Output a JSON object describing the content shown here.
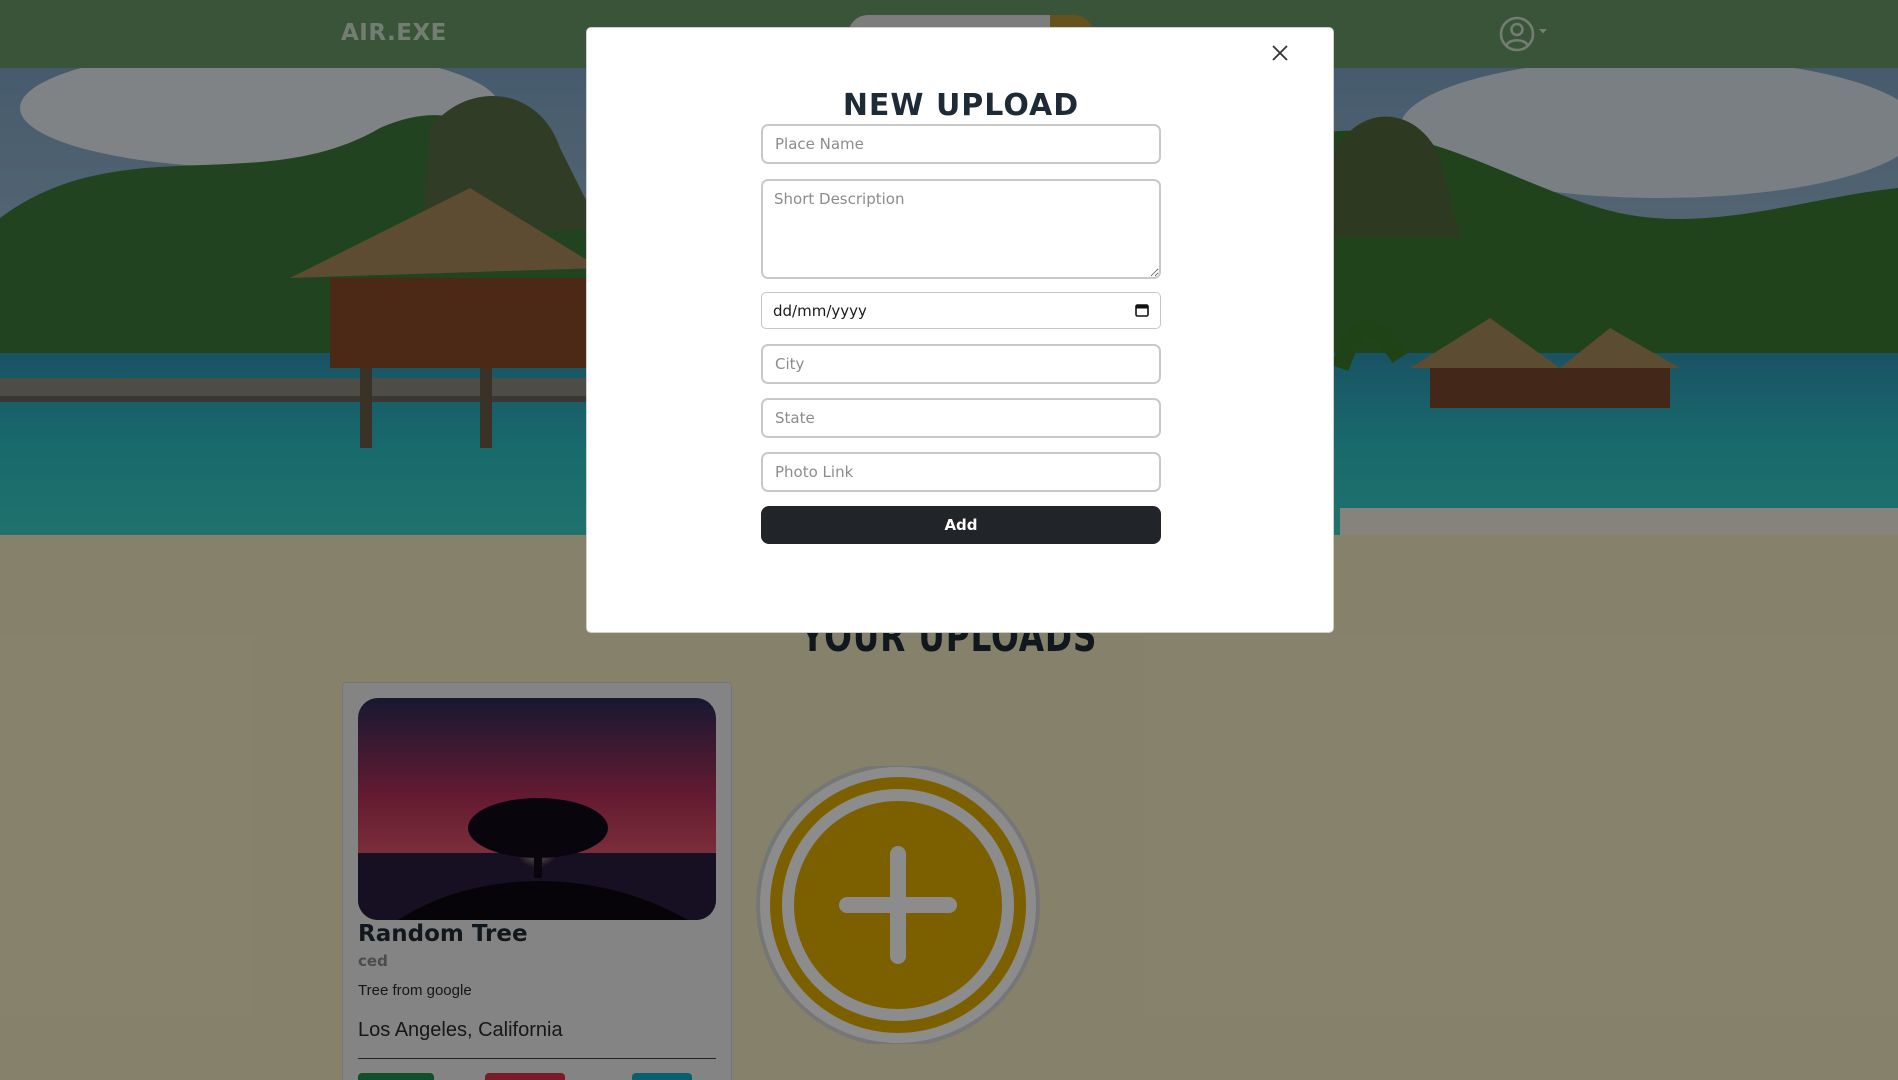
{
  "navbar": {
    "brand": "AIR.EXE",
    "search_icon": "search-icon",
    "user_icon": "user-circle-icon",
    "caret_icon": "caret-down-icon"
  },
  "hero": {
    "image": "tropical overwater bungalows"
  },
  "uploads": {
    "title": "YOUR UPLOADS",
    "cards": [
      {
        "title": "Random Tree",
        "user": "ced",
        "description": "Tree from google",
        "location": "Los Angeles, California"
      }
    ],
    "add_icon": "plus-circle-icon"
  },
  "modal": {
    "title": "NEW UPLOAD",
    "close_icon": "close-icon",
    "place_name_placeholder": "Place Name",
    "description_placeholder": "Short Description",
    "date_value": "dd/mm/yyyy",
    "calendar_icon": "calendar-icon",
    "city_placeholder": "City",
    "state_placeholder": "State",
    "photo_link_placeholder": "Photo Link",
    "add_label": "Add"
  },
  "colors": {
    "navbar": "#6a9a68",
    "page_background": "#f5ecc2",
    "add_button_dark": "#212529",
    "accent_gold": "#e2b000"
  }
}
